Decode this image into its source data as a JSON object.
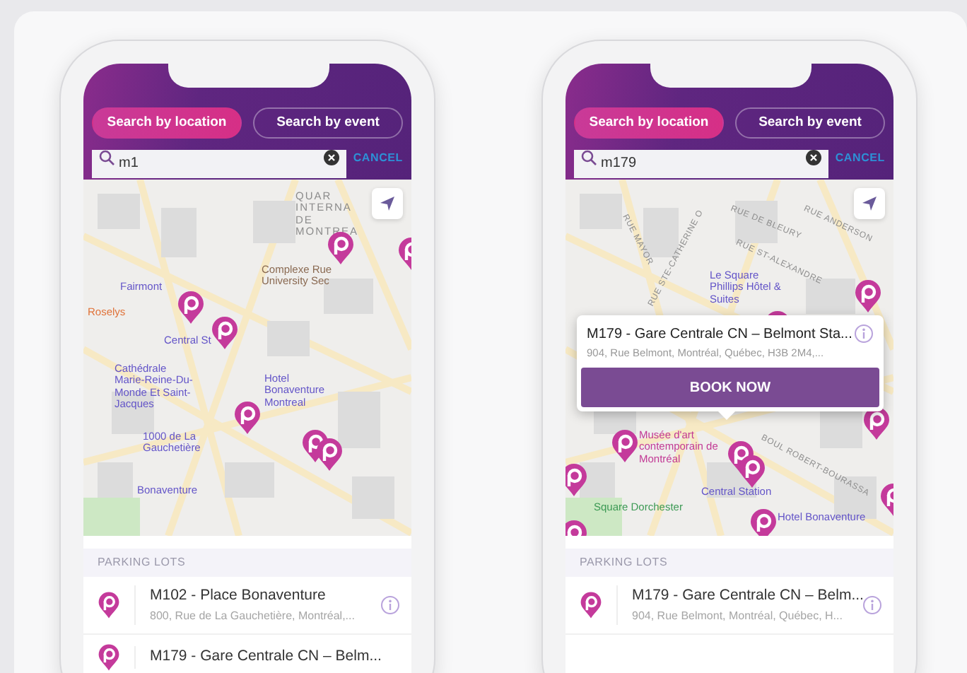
{
  "phones": [
    {
      "tabs": [
        {
          "label": "Search by location",
          "selected": true
        },
        {
          "label": "Search by event",
          "selected": false
        }
      ],
      "search": {
        "value": "m1",
        "cancel": "CANCEL"
      },
      "map": {
        "labels": [
          {
            "text": "QUAR INTERNA DE MONTREA",
            "kind": "district"
          },
          {
            "text": "Complexe Rue University Sec",
            "kind": "shop"
          },
          {
            "text": "Fairmont",
            "kind": "poi"
          },
          {
            "text": "Roselys",
            "kind": "food"
          },
          {
            "text": "Central St",
            "kind": "poi"
          },
          {
            "text": "Cathédrale Marie-Reine-Du-Monde Et Saint-Jacques",
            "kind": "poi"
          },
          {
            "text": "Hotel Bonaventure Montreal",
            "kind": "poi"
          },
          {
            "text": "1000 de La Gauchetière",
            "kind": "poi"
          },
          {
            "text": "Bonaventure",
            "kind": "poi"
          }
        ]
      },
      "list": {
        "header": "PARKING LOTS",
        "items": [
          {
            "title": "M102 - Place Bonaventure",
            "address": "800, Rue de La Gauchetière, Montréal,..."
          },
          {
            "title": "M179 - Gare Centrale CN – Belm..."
          }
        ]
      }
    },
    {
      "tabs": [
        {
          "label": "Search by location",
          "selected": true
        },
        {
          "label": "Search by event",
          "selected": false
        }
      ],
      "search": {
        "value": "m179",
        "cancel": "CANCEL"
      },
      "map": {
        "labels": [
          {
            "text": "RUE DE BLEURY",
            "kind": "street"
          },
          {
            "text": "RUE MAYOR",
            "kind": "street"
          },
          {
            "text": "RUE STE-CATHERINE O",
            "kind": "street"
          },
          {
            "text": "RUE ST-ALEXANDRE",
            "kind": "street"
          },
          {
            "text": "RUE ANDERSON",
            "kind": "street"
          },
          {
            "text": "Le Square Phillips Hôtel & Suites",
            "kind": "poi"
          },
          {
            "text": "Musée d'art contemporain de Montréal",
            "kind": "museum"
          },
          {
            "text": "BOUL ROBERT-BOURASSA",
            "kind": "street"
          },
          {
            "text": "Central Station",
            "kind": "poi"
          },
          {
            "text": "Square Dorchester",
            "kind": "park"
          },
          {
            "text": "Hotel Bonaventure",
            "kind": "poi"
          }
        ]
      },
      "popup": {
        "title": "M179 - Gare Centrale CN – Belmont Sta...",
        "address": "904, Rue Belmont, Montréal, Québec, H3B 2M4,...",
        "button": "BOOK NOW"
      },
      "list": {
        "header": "PARKING LOTS",
        "items": [
          {
            "title": "M179 - Gare Centrale CN – Belm...",
            "address": "904, Rue Belmont, Montréal, Québec, H..."
          }
        ]
      }
    }
  ]
}
